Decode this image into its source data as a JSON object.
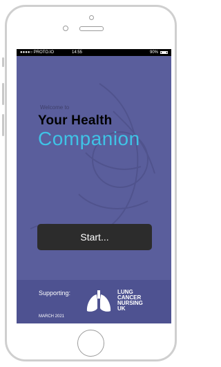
{
  "status_bar": {
    "carrier": "●●●●○ PROTO.IO",
    "time": "14:55",
    "battery": "90%"
  },
  "welcome": {
    "greeting": "Welcome to",
    "title_line1": "Your Health",
    "title_line2": "Companion"
  },
  "start_button": {
    "label": "Start..."
  },
  "footer": {
    "supporting_label": "Supporting:",
    "date": "MARCH 2021",
    "partner_logo": {
      "name": "lung-cancer-nursing-uk-logo",
      "lines": [
        "LUNG",
        "CANCER",
        "NURSING",
        "UK"
      ]
    }
  },
  "colors": {
    "screen_bg": "#5a5e9c",
    "footer_bg": "#4e5291",
    "accent": "#3fc3e6",
    "button_bg": "#2c2c2c"
  }
}
